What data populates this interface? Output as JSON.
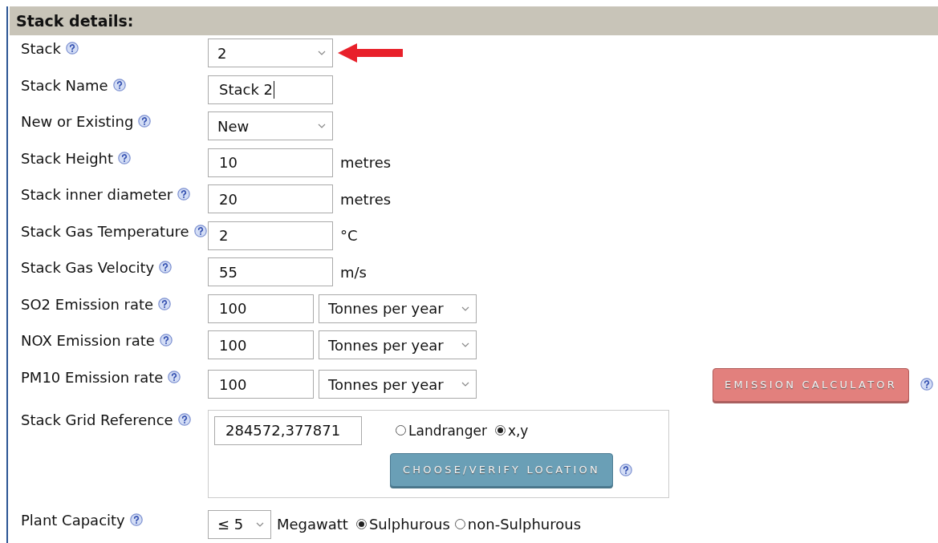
{
  "section": {
    "title": "Stack details:"
  },
  "fields": [
    {
      "kind": "select",
      "label": "Stack",
      "value": "2",
      "highlighted": true
    },
    {
      "kind": "text",
      "label": "Stack Name",
      "value": "Stack 2",
      "focused": true
    },
    {
      "kind": "select",
      "label": "New or Existing",
      "value": "New"
    },
    {
      "kind": "text",
      "label": "Stack Height",
      "value": "10",
      "unit": "metres"
    },
    {
      "kind": "text",
      "label": "Stack inner diameter",
      "value": "20",
      "unit": "metres"
    },
    {
      "kind": "text",
      "label": "Stack Gas Temperature",
      "value": "2",
      "unit": "°C"
    },
    {
      "kind": "text",
      "label": "Stack Gas Velocity",
      "value": "55",
      "unit": "m/s"
    },
    {
      "kind": "text_select",
      "label": "SO2 Emission rate",
      "value": "100",
      "unit_select": "Tonnes per year"
    },
    {
      "kind": "text_select",
      "label": "NOX Emission rate",
      "value": "100",
      "unit_select": "Tonnes per year"
    },
    {
      "kind": "text_select",
      "label": "PM10 Emission rate",
      "value": "100",
      "unit_select": "Tonnes per year",
      "button": "EMISSION CALCULATOR"
    },
    {
      "kind": "grid_ref",
      "label": "Stack Grid Reference",
      "value": "284572,377871",
      "options": [
        {
          "label": "Landranger",
          "selected": false
        },
        {
          "label": "x,y",
          "selected": true
        }
      ],
      "button": "CHOOSE/VERIFY LOCATION"
    },
    {
      "kind": "capacity",
      "label": "Plant Capacity",
      "value": "≤ 5",
      "unit": "Megawatt",
      "options": [
        {
          "label": "Sulphurous",
          "selected": true
        },
        {
          "label": "non-Sulphurous",
          "selected": false
        }
      ]
    }
  ]
}
